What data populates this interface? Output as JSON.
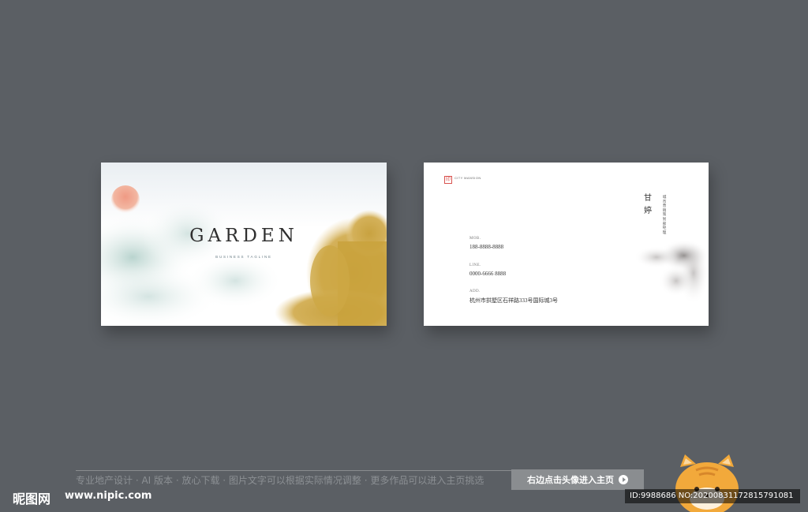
{
  "front_card": {
    "title": "GARDEN",
    "tagline": "BUSINESS TAGLINE"
  },
  "back_card": {
    "logo_mark": "印",
    "logo_text": "CITY MANSION",
    "name": "甘婷",
    "job_title": "城市营销策划部经理",
    "mob_label": "MOB.",
    "mob_value": "188-8888-8888",
    "line_label": "LINE.",
    "line_value": "0000-6666 8888",
    "add_label": "ADD.",
    "add_value": "杭州市拱墅区石祥路333号国际城3号"
  },
  "watermark": {
    "description": "专业地产设计 · AI 版本 · 放心下载 · 图片文字可以根据实际情况调整 · 更多作品可以进入主页挑选",
    "button_label": "右边点击头像进入主页",
    "site_name": "昵图网",
    "site_url": "www.nipic.com",
    "id_text": "ID:9988686 NO:20200831172815791081"
  },
  "colors": {
    "background": "#5b5f64",
    "gold": "#c9a23c",
    "sun": "#e8746a",
    "mist": "#8fb8b0"
  }
}
